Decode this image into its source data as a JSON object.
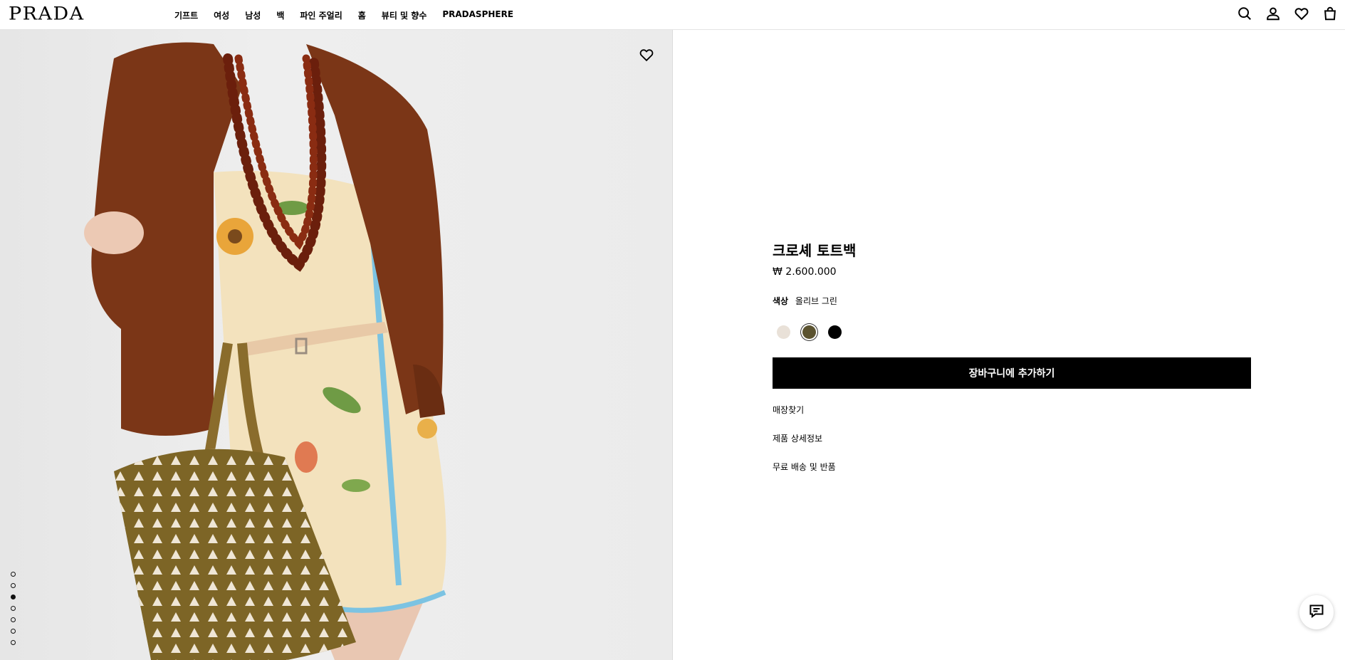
{
  "header": {
    "logo": "PRADA",
    "nav": [
      "기프트",
      "여성",
      "남성",
      "백",
      "파인 주얼리",
      "홈",
      "뷰티 및 향수",
      "PRADASPHERE"
    ],
    "icons": [
      "search-icon",
      "account-icon",
      "wishlist-icon",
      "shopping-bag-icon"
    ]
  },
  "gallery": {
    "image_count": 7,
    "active_index": 2,
    "wishlist_icon": "heart-icon"
  },
  "product": {
    "title": "크로셰 토트백",
    "price": "₩ 2.600.000",
    "color_label": "색상",
    "color_value": "올리브 그린",
    "swatches": [
      {
        "name": "cream",
        "hex": "#e9e1d8",
        "selected": false
      },
      {
        "name": "olive-green",
        "hex": "#5b5330",
        "selected": true
      },
      {
        "name": "black",
        "hex": "#000000",
        "selected": false
      }
    ],
    "add_to_cart": "장바구니에 추가하기",
    "links": [
      "매장찾기",
      "제품 상세정보",
      "무료 배송 및 반품"
    ]
  },
  "chat": {
    "icon": "chat-icon"
  }
}
